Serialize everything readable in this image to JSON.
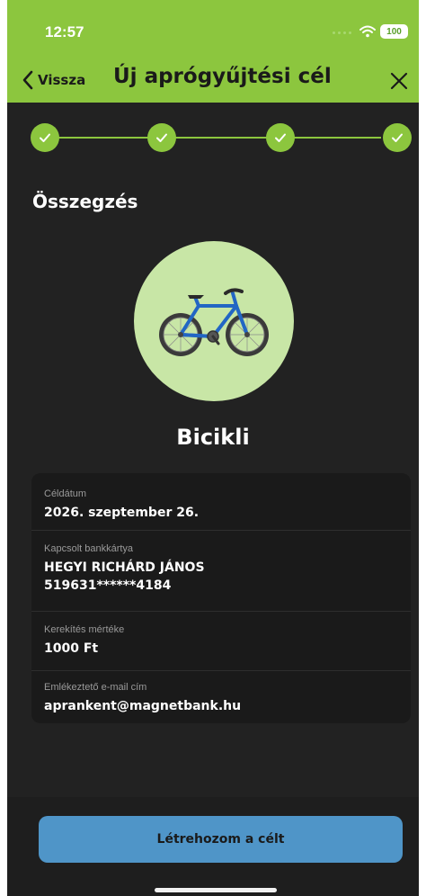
{
  "status_bar": {
    "time": "12:57",
    "battery": "100"
  },
  "header": {
    "back_label": "Vissza",
    "title": "Új aprógyűjtési cél",
    "background": "#8cc63e"
  },
  "stepper": {
    "total_steps": 4,
    "completed_steps": 4,
    "accent": "#8cc63e"
  },
  "summary": {
    "section_title": "Összegzés",
    "goal_icon": "bicycle-icon",
    "goal_name": "Bicikli",
    "rows": [
      {
        "label": "Céldátum",
        "value": "2026. szeptember 26."
      },
      {
        "label": "Kapcsolt bankkártya",
        "value": "HEGYI RICHÁRD JÁNOS",
        "value2": "519631******4184"
      },
      {
        "label": "Kerekítés mértéke",
        "value": "1000 Ft"
      },
      {
        "label": "Emlékeztető e-mail cím",
        "value": "aprankent@magnetbank.hu"
      }
    ]
  },
  "footer": {
    "primary_button_label": "Létrehozom a célt",
    "primary_button_color": "#4f95c8"
  }
}
